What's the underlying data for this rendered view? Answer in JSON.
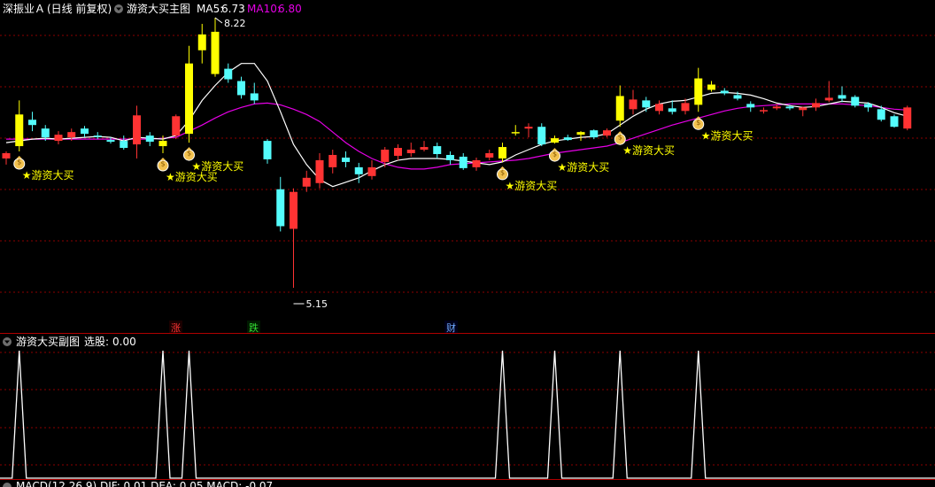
{
  "header": {
    "stock_name": "深振业Ａ",
    "period": "(日线 前复权)",
    "indicator_name": "游资大买主图",
    "ma5_label": "MA5:",
    "ma5_value": "6.73",
    "ma10_label": "MA10:",
    "ma10_value": "6.80"
  },
  "annotations": {
    "high_price": "8.22",
    "low_price": "5.15",
    "signal_label": "游资大买",
    "star": "★"
  },
  "markers": {
    "rise": "涨",
    "fall": "跌",
    "finance": "财"
  },
  "sub_panel": {
    "title": "游资大买副图",
    "select_label": "选股:",
    "select_value": "0.00"
  },
  "footer": {
    "text": "MACD(12,26,9) DIF: 0.01 DEA: 0.05 MACD: -0.07"
  },
  "colors": {
    "up": "#ff3333",
    "down": "#54fcfc",
    "signal": "#ffff00",
    "ma5": "#ffffff",
    "ma10": "#e600e6",
    "grid": "#8b0000",
    "separator": "#b00000"
  },
  "chart_data": {
    "type": "candlestick",
    "price_range": [
      5.0,
      8.4
    ],
    "candles": [
      {
        "o": 6.62,
        "c": 6.68,
        "h": 6.7,
        "l": 6.55,
        "t": "up"
      },
      {
        "o": 6.76,
        "c": 7.12,
        "h": 7.28,
        "l": 6.7,
        "t": "signal"
      },
      {
        "o": 7.0,
        "c": 7.06,
        "h": 7.15,
        "l": 6.93,
        "t": "down"
      },
      {
        "o": 6.96,
        "c": 6.86,
        "h": 7.0,
        "l": 6.82,
        "t": "down"
      },
      {
        "o": 6.82,
        "c": 6.89,
        "h": 6.93,
        "l": 6.78,
        "t": "up"
      },
      {
        "o": 6.86,
        "c": 6.92,
        "h": 6.96,
        "l": 6.82,
        "t": "up"
      },
      {
        "o": 6.96,
        "c": 6.9,
        "h": 6.99,
        "l": 6.86,
        "t": "down"
      },
      {
        "o": 6.88,
        "c": 6.87,
        "h": 6.92,
        "l": 6.84,
        "t": "down"
      },
      {
        "o": 6.83,
        "c": 6.81,
        "h": 6.86,
        "l": 6.79,
        "t": "down"
      },
      {
        "o": 6.82,
        "c": 6.74,
        "h": 6.88,
        "l": 6.72,
        "t": "down"
      },
      {
        "o": 6.78,
        "c": 7.11,
        "h": 7.22,
        "l": 6.62,
        "t": "up"
      },
      {
        "o": 6.88,
        "c": 6.81,
        "h": 6.92,
        "l": 6.76,
        "t": "down"
      },
      {
        "o": 6.76,
        "c": 6.82,
        "h": 6.88,
        "l": 6.68,
        "t": "signal"
      },
      {
        "o": 6.88,
        "c": 7.1,
        "h": 7.12,
        "l": 6.84,
        "t": "up"
      },
      {
        "o": 6.9,
        "c": 7.7,
        "h": 7.9,
        "l": 6.8,
        "t": "signal"
      },
      {
        "o": 7.85,
        "c": 8.03,
        "h": 8.15,
        "l": 7.7,
        "t": "signal"
      },
      {
        "o": 8.06,
        "c": 7.58,
        "h": 8.22,
        "l": 7.55,
        "t": "signal"
      },
      {
        "o": 7.64,
        "c": 7.52,
        "h": 7.7,
        "l": 7.48,
        "t": "down"
      },
      {
        "o": 7.5,
        "c": 7.34,
        "h": 7.55,
        "l": 7.3,
        "t": "down"
      },
      {
        "o": 7.36,
        "c": 7.28,
        "h": 7.48,
        "l": 7.24,
        "t": "down"
      },
      {
        "o": 6.82,
        "c": 6.61,
        "h": 6.84,
        "l": 6.56,
        "t": "down"
      },
      {
        "o": 6.27,
        "c": 5.85,
        "h": 6.41,
        "l": 5.79,
        "t": "down"
      },
      {
        "o": 5.82,
        "c": 6.24,
        "h": 6.28,
        "l": 5.15,
        "t": "up"
      },
      {
        "o": 6.3,
        "c": 6.4,
        "h": 6.48,
        "l": 6.24,
        "t": "up"
      },
      {
        "o": 6.34,
        "c": 6.6,
        "h": 6.68,
        "l": 6.28,
        "t": "up"
      },
      {
        "o": 6.52,
        "c": 6.66,
        "h": 6.72,
        "l": 6.45,
        "t": "up"
      },
      {
        "o": 6.63,
        "c": 6.58,
        "h": 6.7,
        "l": 6.52,
        "t": "down"
      },
      {
        "o": 6.52,
        "c": 6.44,
        "h": 6.57,
        "l": 6.34,
        "t": "down"
      },
      {
        "o": 6.42,
        "c": 6.52,
        "h": 6.6,
        "l": 6.38,
        "t": "up"
      },
      {
        "o": 6.58,
        "c": 6.72,
        "h": 6.75,
        "l": 6.52,
        "t": "up"
      },
      {
        "o": 6.65,
        "c": 6.74,
        "h": 6.78,
        "l": 6.6,
        "t": "up"
      },
      {
        "o": 6.68,
        "c": 6.72,
        "h": 6.8,
        "l": 6.64,
        "t": "up"
      },
      {
        "o": 6.72,
        "c": 6.75,
        "h": 6.82,
        "l": 6.7,
        "t": "up"
      },
      {
        "o": 6.76,
        "c": 6.67,
        "h": 6.8,
        "l": 6.62,
        "t": "down"
      },
      {
        "o": 6.66,
        "c": 6.6,
        "h": 6.7,
        "l": 6.55,
        "t": "down"
      },
      {
        "o": 6.64,
        "c": 6.51,
        "h": 6.68,
        "l": 6.49,
        "t": "down"
      },
      {
        "o": 6.52,
        "c": 6.6,
        "h": 6.63,
        "l": 6.48,
        "t": "up"
      },
      {
        "o": 6.63,
        "c": 6.68,
        "h": 6.72,
        "l": 6.6,
        "t": "up"
      },
      {
        "o": 6.62,
        "c": 6.75,
        "h": 6.8,
        "l": 6.58,
        "t": "signal"
      },
      {
        "o": 6.91,
        "c": 6.92,
        "h": 7.0,
        "l": 6.88,
        "t": "signal"
      },
      {
        "o": 6.96,
        "c": 6.98,
        "h": 7.02,
        "l": 6.86,
        "t": "up"
      },
      {
        "o": 6.98,
        "c": 6.78,
        "h": 7.02,
        "l": 6.76,
        "t": "down"
      },
      {
        "o": 6.8,
        "c": 6.85,
        "h": 6.88,
        "l": 6.79,
        "t": "signal"
      },
      {
        "o": 6.86,
        "c": 6.83,
        "h": 6.89,
        "l": 6.82,
        "t": "down"
      },
      {
        "o": 6.89,
        "c": 6.92,
        "h": 6.93,
        "l": 6.82,
        "t": "signal"
      },
      {
        "o": 6.94,
        "c": 6.86,
        "h": 6.95,
        "l": 6.84,
        "t": "down"
      },
      {
        "o": 6.88,
        "c": 6.94,
        "h": 6.96,
        "l": 6.86,
        "t": "up"
      },
      {
        "o": 7.05,
        "c": 7.33,
        "h": 7.45,
        "l": 6.98,
        "t": "signal"
      },
      {
        "o": 7.18,
        "c": 7.29,
        "h": 7.4,
        "l": 7.12,
        "t": "up"
      },
      {
        "o": 7.28,
        "c": 7.2,
        "h": 7.32,
        "l": 7.15,
        "t": "down"
      },
      {
        "o": 7.16,
        "c": 7.24,
        "h": 7.28,
        "l": 7.12,
        "t": "up"
      },
      {
        "o": 7.19,
        "c": 7.15,
        "h": 7.28,
        "l": 7.12,
        "t": "down"
      },
      {
        "o": 7.16,
        "c": 7.25,
        "h": 7.3,
        "l": 7.12,
        "t": "up"
      },
      {
        "o": 7.23,
        "c": 7.53,
        "h": 7.65,
        "l": 7.15,
        "t": "signal"
      },
      {
        "o": 7.46,
        "c": 7.4,
        "h": 7.5,
        "l": 7.38,
        "t": "signal"
      },
      {
        "o": 7.39,
        "c": 7.36,
        "h": 7.42,
        "l": 7.34,
        "t": "down"
      },
      {
        "o": 7.34,
        "c": 7.3,
        "h": 7.38,
        "l": 7.28,
        "t": "down"
      },
      {
        "o": 7.24,
        "c": 7.2,
        "h": 7.27,
        "l": 7.15,
        "t": "down"
      },
      {
        "o": 7.16,
        "c": 7.17,
        "h": 7.2,
        "l": 7.13,
        "t": "up"
      },
      {
        "o": 7.19,
        "c": 7.21,
        "h": 7.24,
        "l": 7.17,
        "t": "up"
      },
      {
        "o": 7.21,
        "c": 7.19,
        "h": 7.23,
        "l": 7.17,
        "t": "down"
      },
      {
        "o": 7.17,
        "c": 7.2,
        "h": 7.21,
        "l": 7.1,
        "t": "up"
      },
      {
        "o": 7.2,
        "c": 7.25,
        "h": 7.3,
        "l": 7.16,
        "t": "up"
      },
      {
        "o": 7.28,
        "c": 7.31,
        "h": 7.5,
        "l": 7.26,
        "t": "up"
      },
      {
        "o": 7.34,
        "c": 7.3,
        "h": 7.44,
        "l": 7.26,
        "t": "down"
      },
      {
        "o": 7.32,
        "c": 7.22,
        "h": 7.34,
        "l": 7.2,
        "t": "down"
      },
      {
        "o": 7.24,
        "c": 7.2,
        "h": 7.26,
        "l": 7.15,
        "t": "down"
      },
      {
        "o": 7.18,
        "c": 7.06,
        "h": 7.22,
        "l": 7.04,
        "t": "down"
      },
      {
        "o": 7.1,
        "c": 6.98,
        "h": 7.12,
        "l": 6.97,
        "t": "down"
      },
      {
        "o": 6.96,
        "c": 7.2,
        "h": 7.22,
        "l": 6.94,
        "t": "up"
      }
    ],
    "ma5": [
      6.8,
      6.82,
      6.84,
      6.85,
      6.84,
      6.85,
      6.86,
      6.87,
      6.86,
      6.82,
      6.86,
      6.85,
      6.84,
      6.88,
      7.05,
      7.28,
      7.45,
      7.6,
      7.7,
      7.7,
      7.5,
      7.15,
      6.78,
      6.55,
      6.38,
      6.3,
      6.35,
      6.4,
      6.48,
      6.55,
      6.6,
      6.62,
      6.62,
      6.62,
      6.61,
      6.59,
      6.57,
      6.55,
      6.58,
      6.66,
      6.72,
      6.78,
      6.82,
      6.84,
      6.86,
      6.87,
      6.9,
      7.0,
      7.1,
      7.18,
      7.24,
      7.27,
      7.28,
      7.32,
      7.36,
      7.37,
      7.36,
      7.34,
      7.3,
      7.25,
      7.22,
      7.2,
      7.21,
      7.24,
      7.27,
      7.26,
      7.25,
      7.2,
      7.14,
      7.1
    ],
    "ma10": [
      6.84,
      6.84,
      6.84,
      6.84,
      6.84,
      6.84,
      6.84,
      6.84,
      6.84,
      6.84,
      6.84,
      6.84,
      6.85,
      6.86,
      6.93,
      7.0,
      7.08,
      7.15,
      7.2,
      7.24,
      7.25,
      7.23,
      7.18,
      7.12,
      7.04,
      6.92,
      6.8,
      6.7,
      6.62,
      6.56,
      6.52,
      6.5,
      6.5,
      6.52,
      6.55,
      6.56,
      6.57,
      6.58,
      6.59,
      6.6,
      6.62,
      6.65,
      6.68,
      6.7,
      6.72,
      6.74,
      6.76,
      6.8,
      6.85,
      6.9,
      6.95,
      7.0,
      7.04,
      7.08,
      7.12,
      7.16,
      7.19,
      7.21,
      7.22,
      7.23,
      7.24,
      7.24,
      7.24,
      7.24,
      7.24,
      7.23,
      7.22,
      7.2,
      7.18,
      7.17
    ],
    "signal_candle_indices": [
      1,
      12,
      14,
      38,
      42,
      47,
      53
    ],
    "sub_series": {
      "name": "选股",
      "peak_indices": [
        1,
        12,
        14,
        38,
        42,
        47,
        53
      ],
      "range": [
        0,
        1
      ]
    }
  }
}
